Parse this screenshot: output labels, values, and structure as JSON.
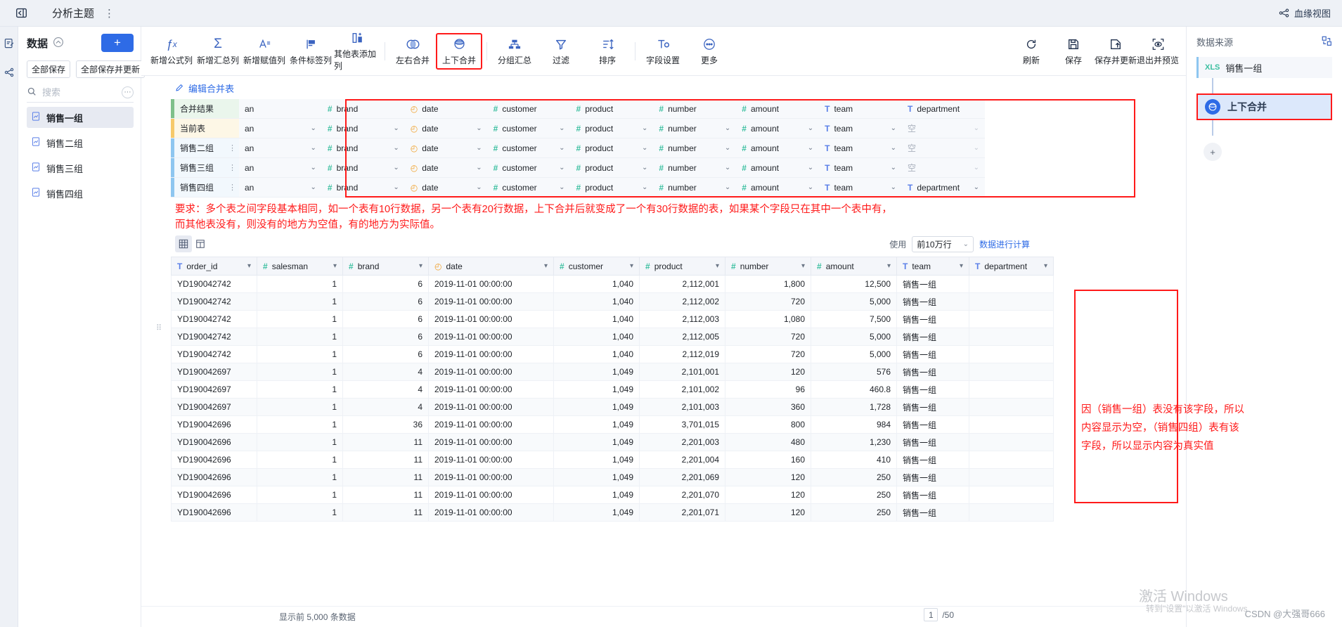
{
  "topbar": {
    "collapse_icon": "collapse-panel-icon",
    "title": "分析主题",
    "menu_dots": "⋮",
    "lineage_label": "血缘视图"
  },
  "rail": {
    "items": [
      {
        "name": "data-prep-icon"
      },
      {
        "name": "lineage-icon"
      }
    ]
  },
  "left_panel": {
    "title": "数据",
    "save_all": "全部保存",
    "save_all_update": "全部保存并更新",
    "search_placeholder": "搜索",
    "search_value": "",
    "add_label": "+",
    "items": [
      {
        "label": "销售一组",
        "selected": true
      },
      {
        "label": "销售二组",
        "selected": false
      },
      {
        "label": "销售三组",
        "selected": false
      },
      {
        "label": "销售四组",
        "selected": false
      }
    ]
  },
  "toolbar": {
    "left_tools": [
      {
        "label": "新增公式列",
        "icon": "fx-icon",
        "glyph": "ƒx"
      },
      {
        "label": "新增汇总列",
        "icon": "sigma-icon",
        "glyph": "Σ"
      },
      {
        "label": "新增赋值列",
        "icon": "assign-column-icon",
        "glyph": "A⁼"
      },
      {
        "label": "条件标签列",
        "icon": "flag-icon",
        "glyph": "⚑"
      },
      {
        "label": "其他表添加列",
        "icon": "add-column-from-table-icon",
        "glyph": "◫"
      },
      {
        "label": "左右合并",
        "icon": "join-horizontal-icon",
        "glyph": "◑"
      },
      {
        "label": "上下合并",
        "icon": "union-vertical-icon",
        "glyph": "◒",
        "highlighted": true
      },
      {
        "label": "分组汇总",
        "icon": "group-summary-icon",
        "glyph": "⊟"
      },
      {
        "label": "过滤",
        "icon": "filter-icon",
        "glyph": "▽"
      },
      {
        "label": "排序",
        "icon": "sort-icon",
        "glyph": "⇅"
      },
      {
        "label": "字段设置",
        "icon": "field-settings-icon",
        "glyph": "Tᴏ"
      },
      {
        "label": "更多",
        "icon": "more-icon",
        "glyph": "⋯"
      }
    ],
    "right_tools": [
      {
        "label": "刷新",
        "icon": "refresh-icon",
        "glyph": "↻"
      },
      {
        "label": "保存",
        "icon": "save-icon",
        "glyph": "🖫"
      },
      {
        "label": "保存并更新",
        "icon": "save-update-icon",
        "glyph": "🖫↑"
      },
      {
        "label": "退出并预览",
        "icon": "preview-exit-icon",
        "glyph": "◎"
      }
    ]
  },
  "merge_editor": {
    "edit_link": "编辑合并表",
    "columns": [
      {
        "field": "salesman",
        "display": "an",
        "type": "number"
      },
      {
        "field": "brand",
        "display": "brand",
        "type": "number"
      },
      {
        "field": "date",
        "display": "date",
        "type": "date"
      },
      {
        "field": "customer",
        "display": "customer",
        "type": "number"
      },
      {
        "field": "product",
        "display": "product",
        "type": "number"
      },
      {
        "field": "number",
        "display": "number",
        "type": "number"
      },
      {
        "field": "amount",
        "display": "amount",
        "type": "number"
      },
      {
        "field": "team",
        "display": "team",
        "type": "text"
      },
      {
        "field": "department",
        "display": "department",
        "type": "text"
      }
    ],
    "rows": [
      {
        "label": "合并结果",
        "kind": "result",
        "has_kebab": false,
        "has_chevron": false,
        "values": [
          "an",
          "brand",
          "date",
          "customer",
          "product",
          "number",
          "amount",
          "team",
          "department"
        ]
      },
      {
        "label": "当前表",
        "kind": "current",
        "has_kebab": false,
        "has_chevron": true,
        "values": [
          "an",
          "brand",
          "date",
          "customer",
          "product",
          "number",
          "amount",
          "team",
          "空"
        ]
      },
      {
        "label": "销售二组",
        "kind": "table",
        "has_kebab": true,
        "has_chevron": true,
        "values": [
          "an",
          "brand",
          "date",
          "customer",
          "product",
          "number",
          "amount",
          "team",
          "空"
        ]
      },
      {
        "label": "销售三组",
        "kind": "table",
        "has_kebab": true,
        "has_chevron": true,
        "values": [
          "an",
          "brand",
          "date",
          "customer",
          "product",
          "number",
          "amount",
          "team",
          "空"
        ]
      },
      {
        "label": "销售四组",
        "kind": "table",
        "has_kebab": true,
        "has_chevron": true,
        "values": [
          "an",
          "brand",
          "date",
          "customer",
          "product",
          "number",
          "amount",
          "team",
          "department"
        ]
      }
    ]
  },
  "annotations": {
    "note_main_line1": "要求：多个表之间字段基本相同，如一个表有10行数据，另一个表有20行数据，上下合并后就变成了一个有30行数据的表，如果某个字段只在其中一个表中有，",
    "note_main_line2": "而其他表没有，则没有的地方为空值，有的地方为实际值。",
    "note_dept": "因（销售一组）表没有该字段，所以内容显示为空，（销售四组）表有该字段，所以显示内容为真实值",
    "red_color": "#ff1a1a"
  },
  "view_bar": {
    "grid_view_icon": "grid-view-icon",
    "column_view_icon": "column-view-icon",
    "use_label": "使用",
    "rows_select": "前10万行",
    "calc_button": "数据进行计算"
  },
  "data_table": {
    "columns": [
      {
        "label": "order_id",
        "type": "text"
      },
      {
        "label": "salesman",
        "type": "number"
      },
      {
        "label": "brand",
        "type": "number"
      },
      {
        "label": "date",
        "type": "date"
      },
      {
        "label": "customer",
        "type": "number"
      },
      {
        "label": "product",
        "type": "number"
      },
      {
        "label": "number",
        "type": "number"
      },
      {
        "label": "amount",
        "type": "number"
      },
      {
        "label": "team",
        "type": "text"
      },
      {
        "label": "department",
        "type": "text"
      }
    ],
    "rows": [
      [
        "YD190042742",
        "1",
        "6",
        "2019-11-01 00:00:00",
        "1,040",
        "2,112,001",
        "1,800",
        "12,500",
        "销售一组",
        ""
      ],
      [
        "YD190042742",
        "1",
        "6",
        "2019-11-01 00:00:00",
        "1,040",
        "2,112,002",
        "720",
        "5,000",
        "销售一组",
        ""
      ],
      [
        "YD190042742",
        "1",
        "6",
        "2019-11-01 00:00:00",
        "1,040",
        "2,112,003",
        "1,080",
        "7,500",
        "销售一组",
        ""
      ],
      [
        "YD190042742",
        "1",
        "6",
        "2019-11-01 00:00:00",
        "1,040",
        "2,112,005",
        "720",
        "5,000",
        "销售一组",
        ""
      ],
      [
        "YD190042742",
        "1",
        "6",
        "2019-11-01 00:00:00",
        "1,040",
        "2,112,019",
        "720",
        "5,000",
        "销售一组",
        ""
      ],
      [
        "YD190042697",
        "1",
        "4",
        "2019-11-01 00:00:00",
        "1,049",
        "2,101,001",
        "120",
        "576",
        "销售一组",
        ""
      ],
      [
        "YD190042697",
        "1",
        "4",
        "2019-11-01 00:00:00",
        "1,049",
        "2,101,002",
        "96",
        "460.8",
        "销售一组",
        ""
      ],
      [
        "YD190042697",
        "1",
        "4",
        "2019-11-01 00:00:00",
        "1,049",
        "2,101,003",
        "360",
        "1,728",
        "销售一组",
        ""
      ],
      [
        "YD190042696",
        "1",
        "36",
        "2019-11-01 00:00:00",
        "1,049",
        "3,701,015",
        "800",
        "984",
        "销售一组",
        ""
      ],
      [
        "YD190042696",
        "1",
        "11",
        "2019-11-01 00:00:00",
        "1,049",
        "2,201,003",
        "480",
        "1,230",
        "销售一组",
        ""
      ],
      [
        "YD190042696",
        "1",
        "11",
        "2019-11-01 00:00:00",
        "1,049",
        "2,201,004",
        "160",
        "410",
        "销售一组",
        ""
      ],
      [
        "YD190042696",
        "1",
        "11",
        "2019-11-01 00:00:00",
        "1,049",
        "2,201,069",
        "120",
        "250",
        "销售一组",
        ""
      ],
      [
        "YD190042696",
        "1",
        "11",
        "2019-11-01 00:00:00",
        "1,049",
        "2,201,070",
        "120",
        "250",
        "销售一组",
        ""
      ],
      [
        "YD190042696",
        "1",
        "11",
        "2019-11-01 00:00:00",
        "1,049",
        "2,201,071",
        "120",
        "250",
        "销售一组",
        ""
      ]
    ]
  },
  "footer": {
    "row_count_text": "显示前 5,000 条数据",
    "page_current": "1",
    "page_total": "/50"
  },
  "right_panel": {
    "title": "数据来源",
    "expand_icon": "expand-graph-icon",
    "source": {
      "badge": "XLS",
      "label": "销售一组"
    },
    "node": {
      "label": "上下合并",
      "icon": "union-vertical-icon",
      "highlighted": true
    },
    "add_label": "+"
  },
  "watermark": {
    "line1": "激活 Windows",
    "line2": "转到\"设置\"以激活 Windows",
    "credit": "CSDN @大强哥666"
  }
}
